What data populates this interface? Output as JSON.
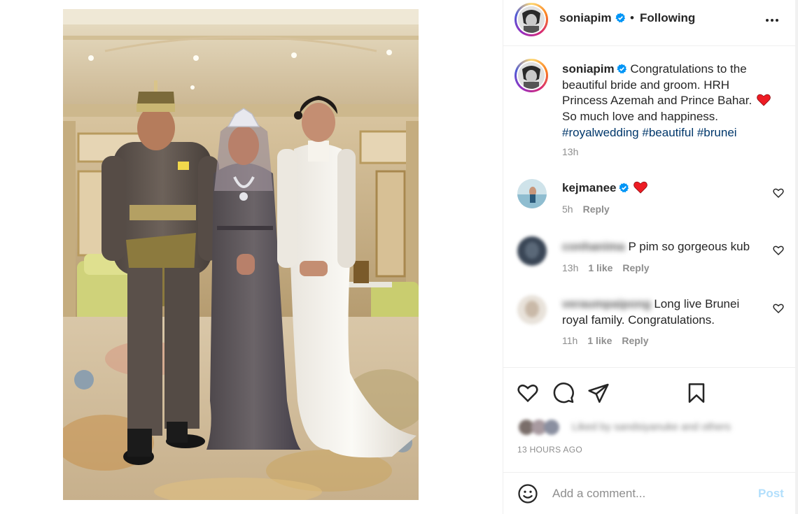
{
  "post": {
    "author": "soniapim",
    "follow_status": "Following",
    "separator": "•",
    "caption": {
      "username": "soniapim",
      "text_line1": "Congratulations to the beautiful bride and groom. HRH Princess Azemah and Prince Bahar.",
      "text_line2": "So much love and happiness.",
      "hashtags": [
        "#royalwedding",
        "#beautiful",
        "#brunei"
      ],
      "time": "13h"
    },
    "comments": [
      {
        "username": "kejmanee",
        "text": "",
        "time": "5h",
        "likes": "",
        "reply": "Reply",
        "verified": true,
        "has_heart_emoji": true
      },
      {
        "username": "conhanima",
        "text": "P pim so gorgeous kub",
        "time": "13h",
        "likes": "1 like",
        "reply": "Reply",
        "blurred_username": true
      },
      {
        "username": "veraumpaipong",
        "text": "Long live Brunei royal family. Congratulations.",
        "time": "11h",
        "likes": "1 like",
        "reply": "Reply",
        "blurred_username": true
      }
    ],
    "liked_by_text": "Liked by sandsiyanuke and others",
    "timestamp": "13 HOURS AGO",
    "add_comment_placeholder": "Add a comment...",
    "post_button": "Post"
  },
  "icons": {
    "more": "more-horizontal-icon",
    "verified": "verified-badge-icon",
    "like": "heart-icon",
    "comment": "comment-bubble-icon",
    "share": "paper-plane-icon",
    "save": "bookmark-icon",
    "emoji": "smiley-icon"
  },
  "colors": {
    "verified_blue": "#0095f6",
    "hashtag": "#00376b",
    "muted": "#8e8e8e",
    "post_disabled": "#b2dffc",
    "heart_red": "#ed1c24"
  }
}
